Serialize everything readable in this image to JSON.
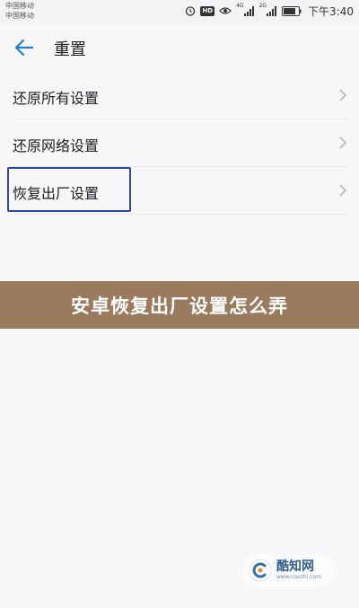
{
  "status_bar": {
    "carrier_1": "中国移动",
    "carrier_2": "中国移动",
    "signal_1_label": "4G",
    "signal_2_label": "2G",
    "time": "下午3:40",
    "hd_badge": "HD",
    "icons": [
      "alarm-icon",
      "hd-icon",
      "eye-icon",
      "signal-icon",
      "signal-icon",
      "battery-icon"
    ]
  },
  "app_bar": {
    "title": "重置"
  },
  "menu": {
    "items": [
      {
        "label": "还原所有设置"
      },
      {
        "label": "还原网络设置"
      },
      {
        "label": "恢复出厂设置"
      }
    ]
  },
  "banner": {
    "text": "安卓恢复出厂设置怎么弄"
  },
  "watermark": {
    "name": "酷知网",
    "url": "www.coozhi.com"
  },
  "colors": {
    "accent": "#1e7fd6",
    "highlight_border": "#3045a8",
    "banner_bg": "#9a7b5d"
  }
}
